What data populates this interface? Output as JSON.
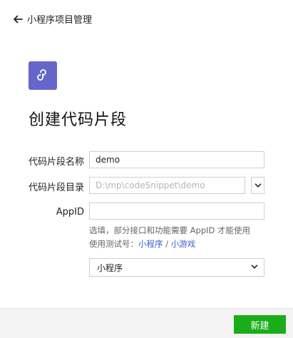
{
  "header": {
    "back_label": "小程序项目管理"
  },
  "page": {
    "title": "创建代码片段"
  },
  "form": {
    "name": {
      "label": "代码片段名称",
      "value": "demo"
    },
    "directory": {
      "label": "代码片段目录",
      "placeholder": "D:\\mp\\codeSnippet\\demo"
    },
    "appid": {
      "label": "AppID",
      "value": "",
      "hint": "选填，部分接口和功能需要 AppID 才能使用",
      "hint2_prefix": "使用测试号：",
      "hint2_link1": "小程序",
      "hint2_sep": " / ",
      "hint2_link2": "小游戏"
    },
    "type_select": {
      "selected": "小程序"
    }
  },
  "footer": {
    "create_label": "新建"
  },
  "colors": {
    "logo_bg": "#6467c9",
    "primary": "#1aad19",
    "link": "#3a5fcd"
  }
}
